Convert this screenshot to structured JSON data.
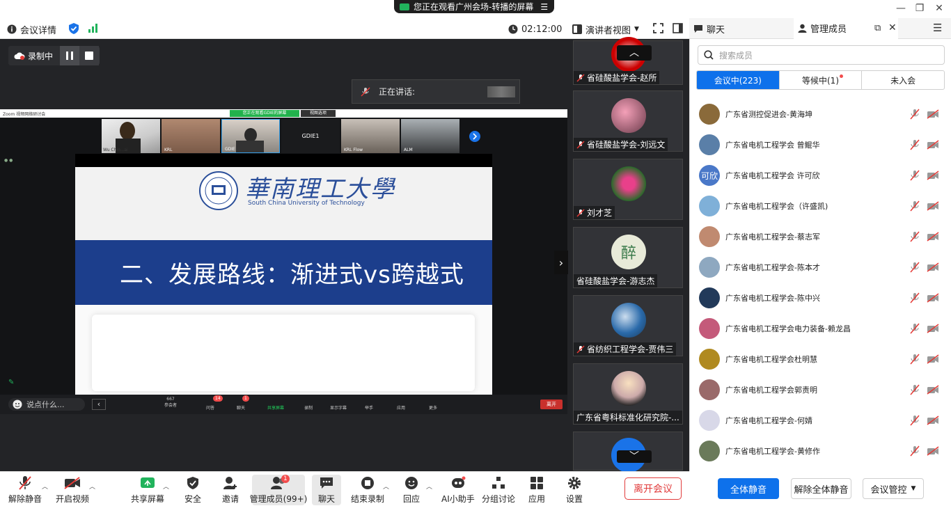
{
  "banner": {
    "text": "您正在观看广州会场-转播的屏幕"
  },
  "infobar": {
    "meeting_details": "会议详情",
    "timer": "02:12:00",
    "view_mode": "演讲者视图"
  },
  "recording": {
    "label": "录制中"
  },
  "speaking": {
    "label": "正在讲话:"
  },
  "shared": {
    "window_title": "Zoom 视频网络研讨会",
    "green_bar": "您正在观看GDIE的屏幕",
    "options": "视图选项",
    "thumb_labels": [
      "Wu Chio...ai",
      "KRL",
      "GDIE",
      "GDIE1",
      "KRL Flow",
      "ALM"
    ],
    "gdie1_label": "GDIE1",
    "slide": {
      "univ_cn": "華南理工大學",
      "univ_en": "South China University of Technology",
      "heading": "二、发展路线：渐进式vs跨越式"
    },
    "chat_prompt": "说点什么...",
    "ctl_labels": [
      "参会者",
      "问答",
      "聊天",
      "共享屏幕",
      "录制",
      "显示字幕",
      "举手",
      "应用",
      "更多"
    ],
    "ctl_count": "667",
    "ctl_badge_qa": "14",
    "ctl_badge_chat": "1",
    "leave_btn": "离开"
  },
  "gallery": [
    {
      "name": "省硅酸盐学会-赵所"
    },
    {
      "name": "省硅酸盐学会-刘远文"
    },
    {
      "name": "刘才芝"
    },
    {
      "name": "省硅酸盐学会-游志杰",
      "avatar_text": "醉"
    },
    {
      "name": "省纺织工程学会-贾伟三"
    },
    {
      "name": "广东省粤科标准化研究院-..."
    }
  ],
  "panel": {
    "tab_chat": "聊天",
    "tab_members": "管理成员",
    "search_placeholder": "搜索成员",
    "segments": [
      "会议中(223)",
      "等候中(1)",
      "未入会"
    ],
    "members": [
      {
        "name": "广东省测控促进会-黄海坤",
        "color": "#8a6a3a"
      },
      {
        "name": "广东省电机工程学会 曾鲲华",
        "color": "#5a7fa8"
      },
      {
        "name": "广东省电机工程学会 许可欣",
        "color": "#4a78c8",
        "avatar_text": "可欣"
      },
      {
        "name": "广东省电机工程学会（许盛凯)",
        "color": "#7fb0d8"
      },
      {
        "name": "广东省电机工程学会-蔡志军",
        "color": "#c08a70"
      },
      {
        "name": "广东省电机工程学会-陈本才",
        "color": "#8ea8c0"
      },
      {
        "name": "广东省电机工程学会-陈中兴",
        "color": "#223a5a"
      },
      {
        "name": "广东省电机工程学会电力装备-赖龙昌",
        "color": "#c45a7a"
      },
      {
        "name": "广东省电机工程学会杜明慧",
        "color": "#b08a20"
      },
      {
        "name": "广东省电机工程学会郭责明",
        "color": "#9a6a6a"
      },
      {
        "name": "广东省电机工程学会-何婧",
        "color": "#d8d8e8"
      },
      {
        "name": "广东省电机工程学会-黄修作",
        "color": "#6a7a5a"
      }
    ],
    "mute_all": "全体静音",
    "unmute_all": "解除全体静音",
    "control": "会议管控"
  },
  "toolbar": {
    "unmute": "解除静音",
    "video": "开启视频",
    "share": "共享屏幕",
    "security": "安全",
    "invite": "邀请",
    "members": "管理成员(99+)",
    "members_badge": "1",
    "chat": "聊天",
    "stop_rec": "结束录制",
    "react": "回应",
    "ai": "AI小助手",
    "breakout": "分组讨论",
    "apps": "应用",
    "settings": "设置",
    "leave": "离开会议"
  }
}
